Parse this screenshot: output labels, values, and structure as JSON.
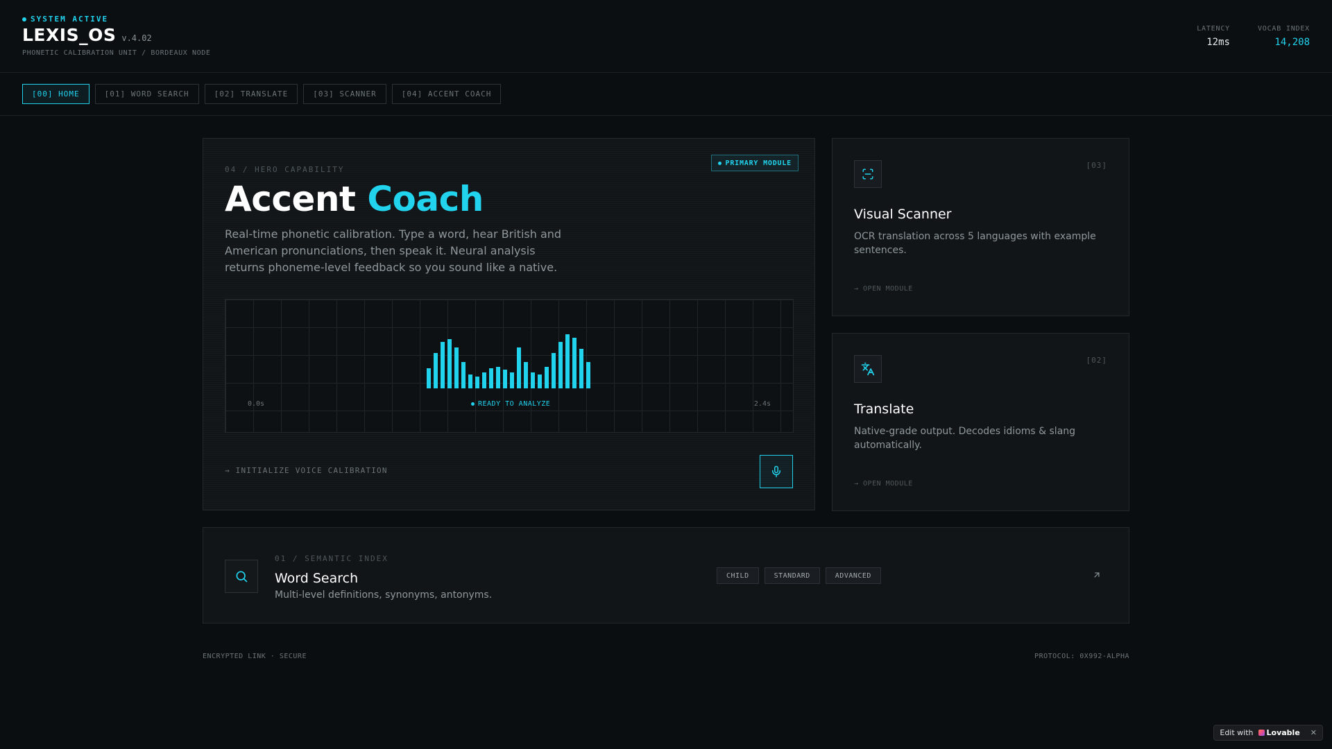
{
  "header": {
    "status": "SYSTEM ACTIVE",
    "brand": "LEXIS_OS",
    "version": "v.4.02",
    "subtitle": "PHONETIC CALIBRATION UNIT / BORDEAUX NODE",
    "metrics": [
      {
        "label": "LATENCY",
        "value": "12ms"
      },
      {
        "label": "VOCAB INDEX",
        "value": "14,208"
      }
    ]
  },
  "nav": {
    "tabs": [
      {
        "label": "[00] HOME",
        "active": true
      },
      {
        "label": "[01] WORD SEARCH",
        "active": false
      },
      {
        "label": "[02] TRANSLATE",
        "active": false
      },
      {
        "label": "[03] SCANNER",
        "active": false
      },
      {
        "label": "[04] ACCENT COACH",
        "active": false
      }
    ]
  },
  "hero": {
    "eyebrow": "04 / HERO CAPABILITY",
    "badge": "PRIMARY MODULE",
    "title_main": "Accent",
    "title_accent": "Coach",
    "description": "Real-time phonetic calibration. Type a word, hear British and American pronunciations, then speak it. Neural analysis returns phoneme-level feedback so you sound like a native.",
    "waveform": {
      "start_label": "0.0s",
      "end_label": "2.4s",
      "status": "READY TO ANALYZE",
      "levels": [
        0.29,
        0.51,
        0.67,
        0.71,
        0.59,
        0.38,
        0.2,
        0.17,
        0.23,
        0.29,
        0.31,
        0.27,
        0.23,
        0.59,
        0.38,
        0.23,
        0.2,
        0.31,
        0.51,
        0.67,
        0.78,
        0.73,
        0.57,
        0.38
      ]
    },
    "cta": "→ INITIALIZE VOICE CALIBRATION",
    "mic_icon": "microphone-icon"
  },
  "modules": {
    "scanner": {
      "index": "[03]",
      "title": "Visual Scanner",
      "description": "OCR translation across 5 languages with example sentences.",
      "open": "→ OPEN MODULE",
      "icon": "scan-icon"
    },
    "translate": {
      "index": "[02]",
      "title": "Translate",
      "description": "Native-grade output. Decodes idioms & slang automatically.",
      "open": "→ OPEN MODULE",
      "icon": "translate-icon"
    }
  },
  "word_search": {
    "eyebrow": "01 / SEMANTIC INDEX",
    "title": "Word Search",
    "description": "Multi-level definitions, synonyms, antonyms.",
    "levels": [
      "CHILD",
      "STANDARD",
      "ADVANCED"
    ],
    "icon": "search-icon"
  },
  "footer": {
    "left": "ENCRYPTED LINK · SECURE",
    "right": "PROTOCOL: 0X992-ALPHA"
  },
  "lovable": {
    "prefix": "Edit with",
    "brand": "Lovable",
    "close": "✕"
  },
  "colors": {
    "accent": "#22d3ee",
    "background": "#0b0e11",
    "card": "#121518"
  }
}
